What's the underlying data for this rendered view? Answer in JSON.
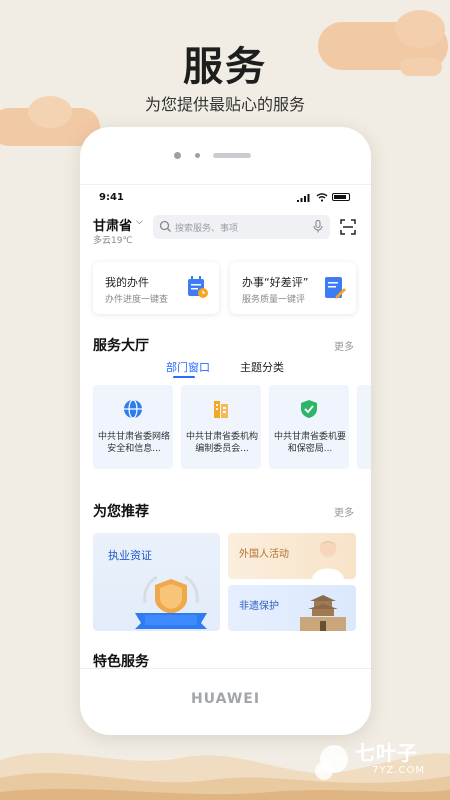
{
  "hero": {
    "title": "服务",
    "subtitle": "为您提供最贴心的服务"
  },
  "device": {
    "brand": "HUAWEI"
  },
  "status_bar": {
    "time": "9:41"
  },
  "header": {
    "location": "甘肃省",
    "weather": "多云19℃",
    "search_placeholder": "搜索服务、事项"
  },
  "quick_cards": [
    {
      "title": "我的办件",
      "subtitle": "办件进度一键查",
      "icon": "calendar-clock-icon"
    },
    {
      "title": "办事“好差评”",
      "subtitle": "服务质量一键评",
      "icon": "edit-document-icon"
    }
  ],
  "service_hall": {
    "title": "服务大厅",
    "more": "更多",
    "tabs": [
      {
        "label": "部门窗口",
        "active": true
      },
      {
        "label": "主题分类",
        "active": false
      }
    ],
    "departments": [
      {
        "name": "中共甘肃省委网络安全和信息...",
        "icon": "globe-icon"
      },
      {
        "name": "中共甘肃省委机构编制委员会...",
        "icon": "building-icon"
      },
      {
        "name": "中共甘肃省委机要和保密局...",
        "icon": "shield-check-icon"
      }
    ]
  },
  "recommend": {
    "title": "为您推荐",
    "more": "更多",
    "items": [
      {
        "label": "执业资证"
      },
      {
        "label": "外国人活动"
      },
      {
        "label": "非遗保护"
      }
    ]
  },
  "featured": {
    "title": "特色服务"
  },
  "watermark": {
    "text": "七叶子",
    "sub": "7YZ.COM"
  },
  "colors": {
    "accent": "#2a6cff",
    "background": "#f1ede4",
    "cloud": "#f2c9a5",
    "shield_green": "#2fb56a",
    "building_orange": "#f5a623"
  }
}
